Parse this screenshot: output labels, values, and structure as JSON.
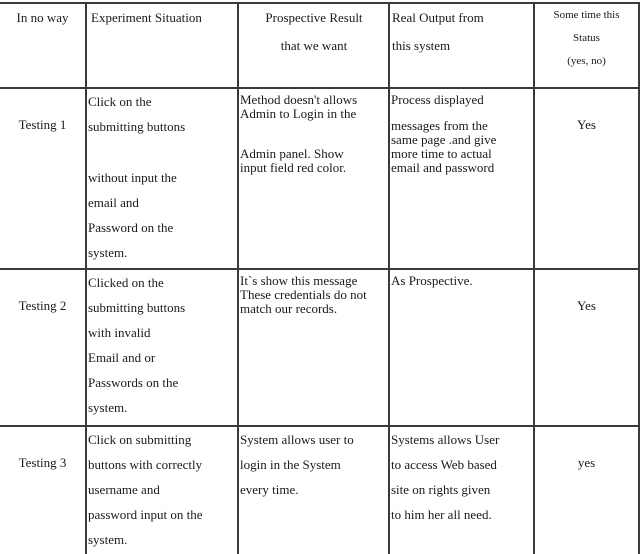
{
  "table": {
    "headers": {
      "col0": "In no way",
      "col1": "Experiment  Situation",
      "col2": [
        "Prospective  Result",
        "that  we  want"
      ],
      "col3": [
        "Real Output  from",
        "this  system"
      ],
      "col4": [
        "Some  time  this",
        "Status",
        "(yes,  no)"
      ]
    },
    "rows": [
      {
        "id": "Testing  1",
        "situation": [
          "Click  on the",
          "submitting  buttons",
          "without  input  the",
          "email  and",
          "Password on the",
          "system."
        ],
        "prospective": [
          "Method doesn't allows",
          "Admin to Login in the",
          "Admin panel. Show",
          "input  field  red color."
        ],
        "real_output": [
          "Process displayed",
          "messages  from  the",
          "same page .and give",
          "more time to actual",
          "email  and password"
        ],
        "status": "Yes"
      },
      {
        "id": "Testing  2",
        "situation": [
          "Clicked  on the",
          "submitting  buttons",
          "with  invalid",
          "Email   and or",
          "Passwords on the",
          "system."
        ],
        "prospective": [
          "It`s show this  message",
          "These credentials do not",
          "match our records."
        ],
        "real_output": [
          "As Prospective."
        ],
        "status": "Yes"
      },
      {
        "id": "Testing  3",
        "situation": [
          "Click  on submitting",
          "buttons  with  correctly",
          "username  and",
          "password input  on the",
          "system."
        ],
        "prospective": [
          "System allows  user to",
          "login  in the System",
          "every  time."
        ],
        "real_output": [
          "Systems allows  User",
          "to access Web based",
          "site on rights  given",
          "to him  her all need."
        ],
        "status": "yes"
      }
    ]
  }
}
